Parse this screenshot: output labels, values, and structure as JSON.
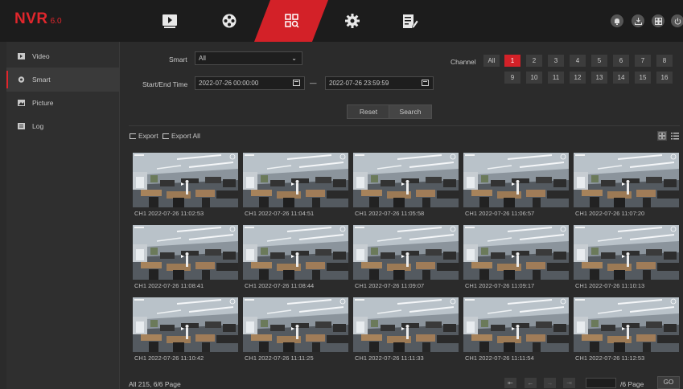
{
  "app": {
    "logo_main": "NVR",
    "logo_version": "6.0"
  },
  "topnav": [
    {
      "name": "playback",
      "icon": "play-icon"
    },
    {
      "name": "config",
      "icon": "film-reel-icon"
    },
    {
      "name": "search",
      "icon": "file-search-icon",
      "active": true
    },
    {
      "name": "settings",
      "icon": "gear-icon"
    },
    {
      "name": "system",
      "icon": "edit-list-icon"
    }
  ],
  "topright": [
    "bell-icon",
    "download-icon",
    "layout-icon",
    "power-icon"
  ],
  "sidebar": {
    "items": [
      {
        "label": "Video",
        "icon": "video-icon"
      },
      {
        "label": "Smart",
        "icon": "smart-icon",
        "active": true
      },
      {
        "label": "Picture",
        "icon": "picture-icon"
      },
      {
        "label": "Log",
        "icon": "log-icon"
      }
    ]
  },
  "filters": {
    "smart_label": "Smart",
    "smart_value": "All",
    "time_label": "Start/End Time",
    "start_time": "2022-07-26 00:00:00",
    "separator": "—",
    "end_time": "2022-07-26 23:59:59",
    "reset_label": "Reset",
    "search_label": "Search"
  },
  "channels": {
    "label": "Channel",
    "all_label": "All",
    "selected": "1",
    "list": [
      "1",
      "2",
      "3",
      "4",
      "5",
      "6",
      "7",
      "8",
      "9",
      "10",
      "11",
      "12",
      "13",
      "14",
      "15",
      "16"
    ]
  },
  "toolbar": {
    "export_label": "Export",
    "export_all_label": "Export All"
  },
  "thumbnails": [
    "CH1 2022-07-26 11:02:53",
    "CH1 2022-07-26 11:04:51",
    "CH1 2022-07-26 11:05:58",
    "CH1 2022-07-26 11:06:57",
    "CH1 2022-07-26 11:07:20",
    "CH1 2022-07-26 11:08:41",
    "CH1 2022-07-26 11:08:44",
    "CH1 2022-07-26 11:09:07",
    "CH1 2022-07-26 11:09:17",
    "CH1 2022-07-26 11:10:13",
    "CH1 2022-07-26 11:10:42",
    "CH1 2022-07-26 11:11:25",
    "CH1 2022-07-26 11:11:33",
    "CH1 2022-07-26 11:11:54",
    "CH1 2022-07-26 11:12:53"
  ],
  "pager": {
    "summary": "All 215, 6/6 Page",
    "page_suffix": "/6 Page",
    "go_label": "GO"
  },
  "colors": {
    "accent": "#d32128",
    "background": "#2b2b2b",
    "topbar": "#1c1c1c"
  }
}
